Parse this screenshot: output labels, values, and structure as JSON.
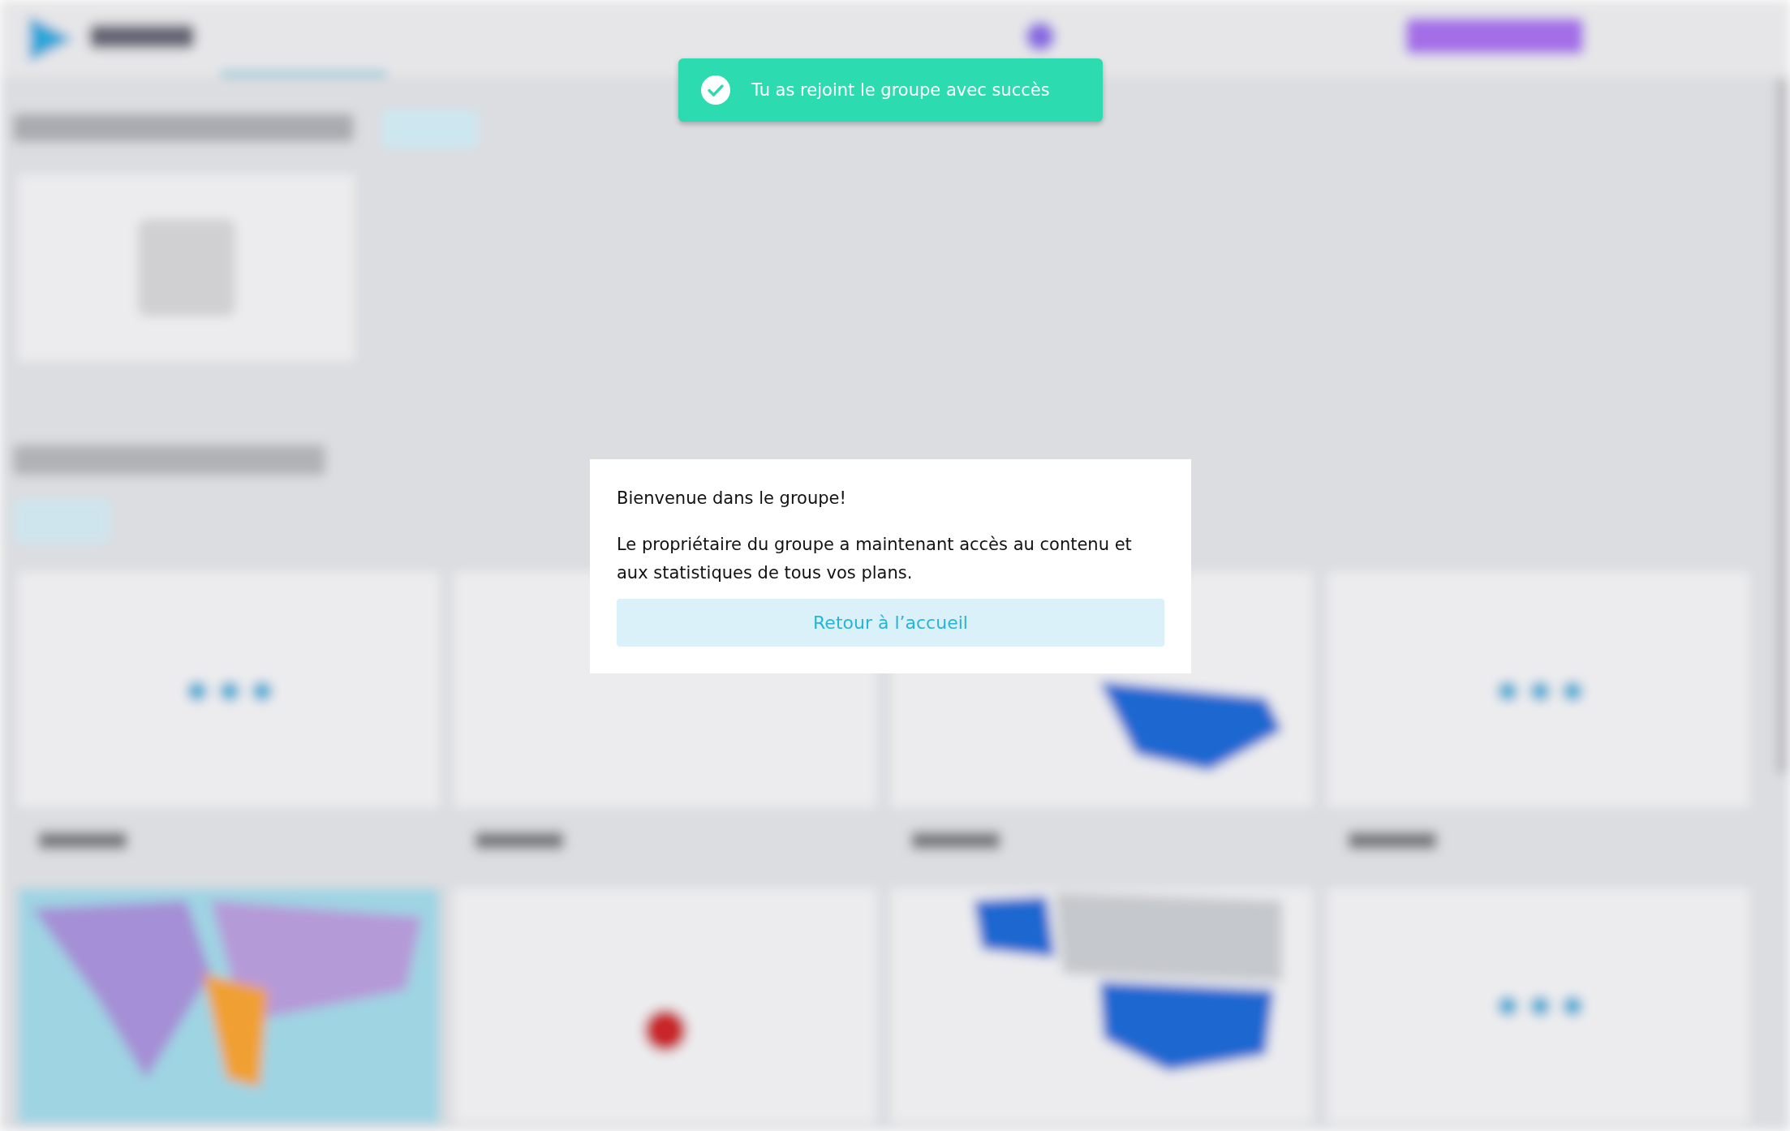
{
  "toast": {
    "message": "Tu as rejoint le groupe avec succès"
  },
  "dialog": {
    "title": "Bienvenue dans le groupe!",
    "body": "Le propriétaire du groupe a maintenant accès au contenu et aux statistiques de tous vos plans.",
    "button": "Retour à l’accueil"
  }
}
